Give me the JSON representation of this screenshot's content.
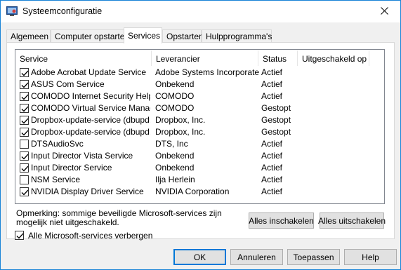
{
  "window": {
    "title": "Systeemconfiguratie"
  },
  "tabs": [
    {
      "label": "Algemeen"
    },
    {
      "label": "Computer opstarten"
    },
    {
      "label": "Services",
      "active": true
    },
    {
      "label": "Opstarten"
    },
    {
      "label": "Hulpprogramma's"
    }
  ],
  "table": {
    "columns": [
      "Service",
      "Leverancier",
      "Status",
      "Uitgeschakeld op"
    ],
    "rows": [
      {
        "checked": true,
        "service": "Adobe Acrobat Update Service",
        "vendor": "Adobe Systems Incorporated",
        "status": "Actief",
        "disabled_on": ""
      },
      {
        "checked": true,
        "service": "ASUS Com Service",
        "vendor": "Onbekend",
        "status": "Actief",
        "disabled_on": ""
      },
      {
        "checked": true,
        "service": "COMODO Internet Security Help...",
        "vendor": "COMODO",
        "status": "Actief",
        "disabled_on": ""
      },
      {
        "checked": true,
        "service": "COMODO Virtual Service Manager",
        "vendor": "COMODO",
        "status": "Gestopt",
        "disabled_on": ""
      },
      {
        "checked": true,
        "service": "Dropbox-update-service (dbupd...",
        "vendor": "Dropbox, Inc.",
        "status": "Gestopt",
        "disabled_on": ""
      },
      {
        "checked": true,
        "service": "Dropbox-update-service (dbupd...",
        "vendor": "Dropbox, Inc.",
        "status": "Gestopt",
        "disabled_on": ""
      },
      {
        "checked": false,
        "service": "DTSAudioSvc",
        "vendor": "DTS, Inc",
        "status": "Actief",
        "disabled_on": ""
      },
      {
        "checked": true,
        "service": "Input Director Vista Service",
        "vendor": "Onbekend",
        "status": "Actief",
        "disabled_on": ""
      },
      {
        "checked": true,
        "service": "Input Director Service",
        "vendor": "Onbekend",
        "status": "Actief",
        "disabled_on": ""
      },
      {
        "checked": false,
        "service": "NSM Service",
        "vendor": "Ilja Herlein",
        "status": "Actief",
        "disabled_on": ""
      },
      {
        "checked": true,
        "service": "NVIDIA Display Driver Service",
        "vendor": "NVIDIA Corporation",
        "status": "Actief",
        "disabled_on": ""
      }
    ]
  },
  "note": "Opmerking: sommige beveiligde Microsoft-services zijn mogelijk niet uitgeschakeld.",
  "buttons": {
    "enable_all": "Alles inschakelen",
    "disable_all": "Alles uitschakelen",
    "ok": "OK",
    "cancel": "Annuleren",
    "apply": "Toepassen",
    "help": "Help"
  },
  "hide_ms": {
    "label": "Alle Microsoft-services verbergen",
    "checked": true
  }
}
